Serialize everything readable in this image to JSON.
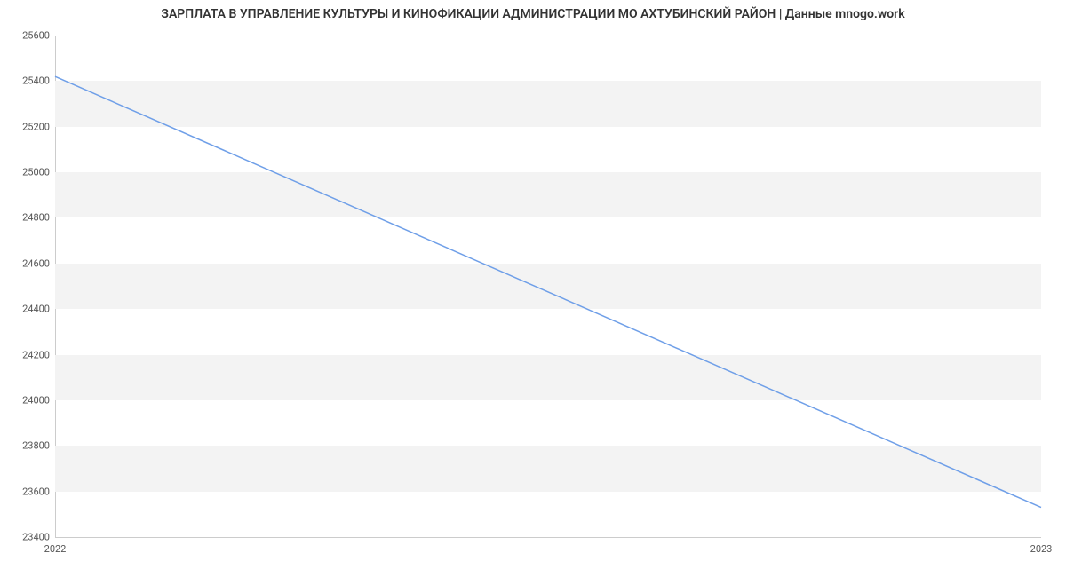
{
  "chart_data": {
    "type": "line",
    "title": "ЗАРПЛАТА В УПРАВЛЕНИЕ КУЛЬТУРЫ И КИНОФИКАЦИИ АДМИНИСТРАЦИИ МО АХТУБИНСКИЙ РАЙОН | Данные mnogo.work",
    "x": [
      2022,
      2023
    ],
    "values": [
      25420,
      23530
    ],
    "xlabel": "",
    "ylabel": "",
    "ylim": [
      23400,
      25600
    ],
    "y_ticks": [
      23400,
      23600,
      23800,
      24000,
      24200,
      24400,
      24600,
      24800,
      25000,
      25200,
      25400,
      25600
    ],
    "x_ticks": [
      2022,
      2023
    ]
  }
}
